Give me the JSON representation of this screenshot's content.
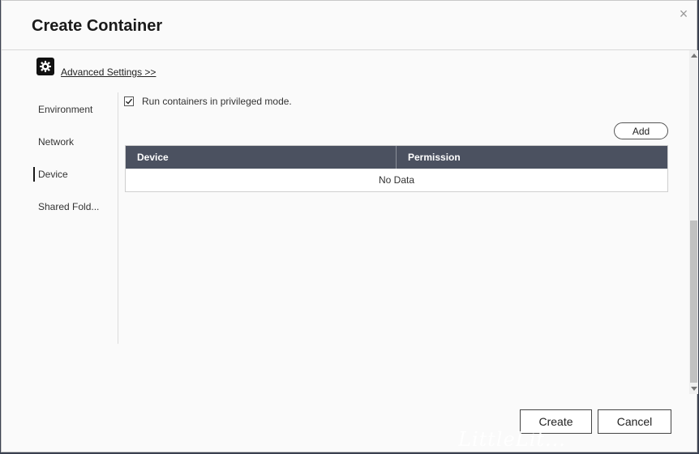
{
  "dialog": {
    "title": "Create Container",
    "close_icon": "close-icon"
  },
  "advanced": {
    "icon": "gear-icon",
    "link": "Advanced Settings >>"
  },
  "nav": {
    "items": [
      {
        "label": "Environment",
        "active": false
      },
      {
        "label": "Network",
        "active": false
      },
      {
        "label": "Device",
        "active": true
      },
      {
        "label": "Shared Fold..."
      }
    ]
  },
  "device_panel": {
    "privileged_checked": true,
    "privileged_label": "Run containers in privileged mode.",
    "add_label": "Add",
    "columns": [
      "Device",
      "Permission"
    ],
    "empty_text": "No Data"
  },
  "footer": {
    "create_label": "Create",
    "cancel_label": "Cancel"
  },
  "watermark": "LittleLit..."
}
